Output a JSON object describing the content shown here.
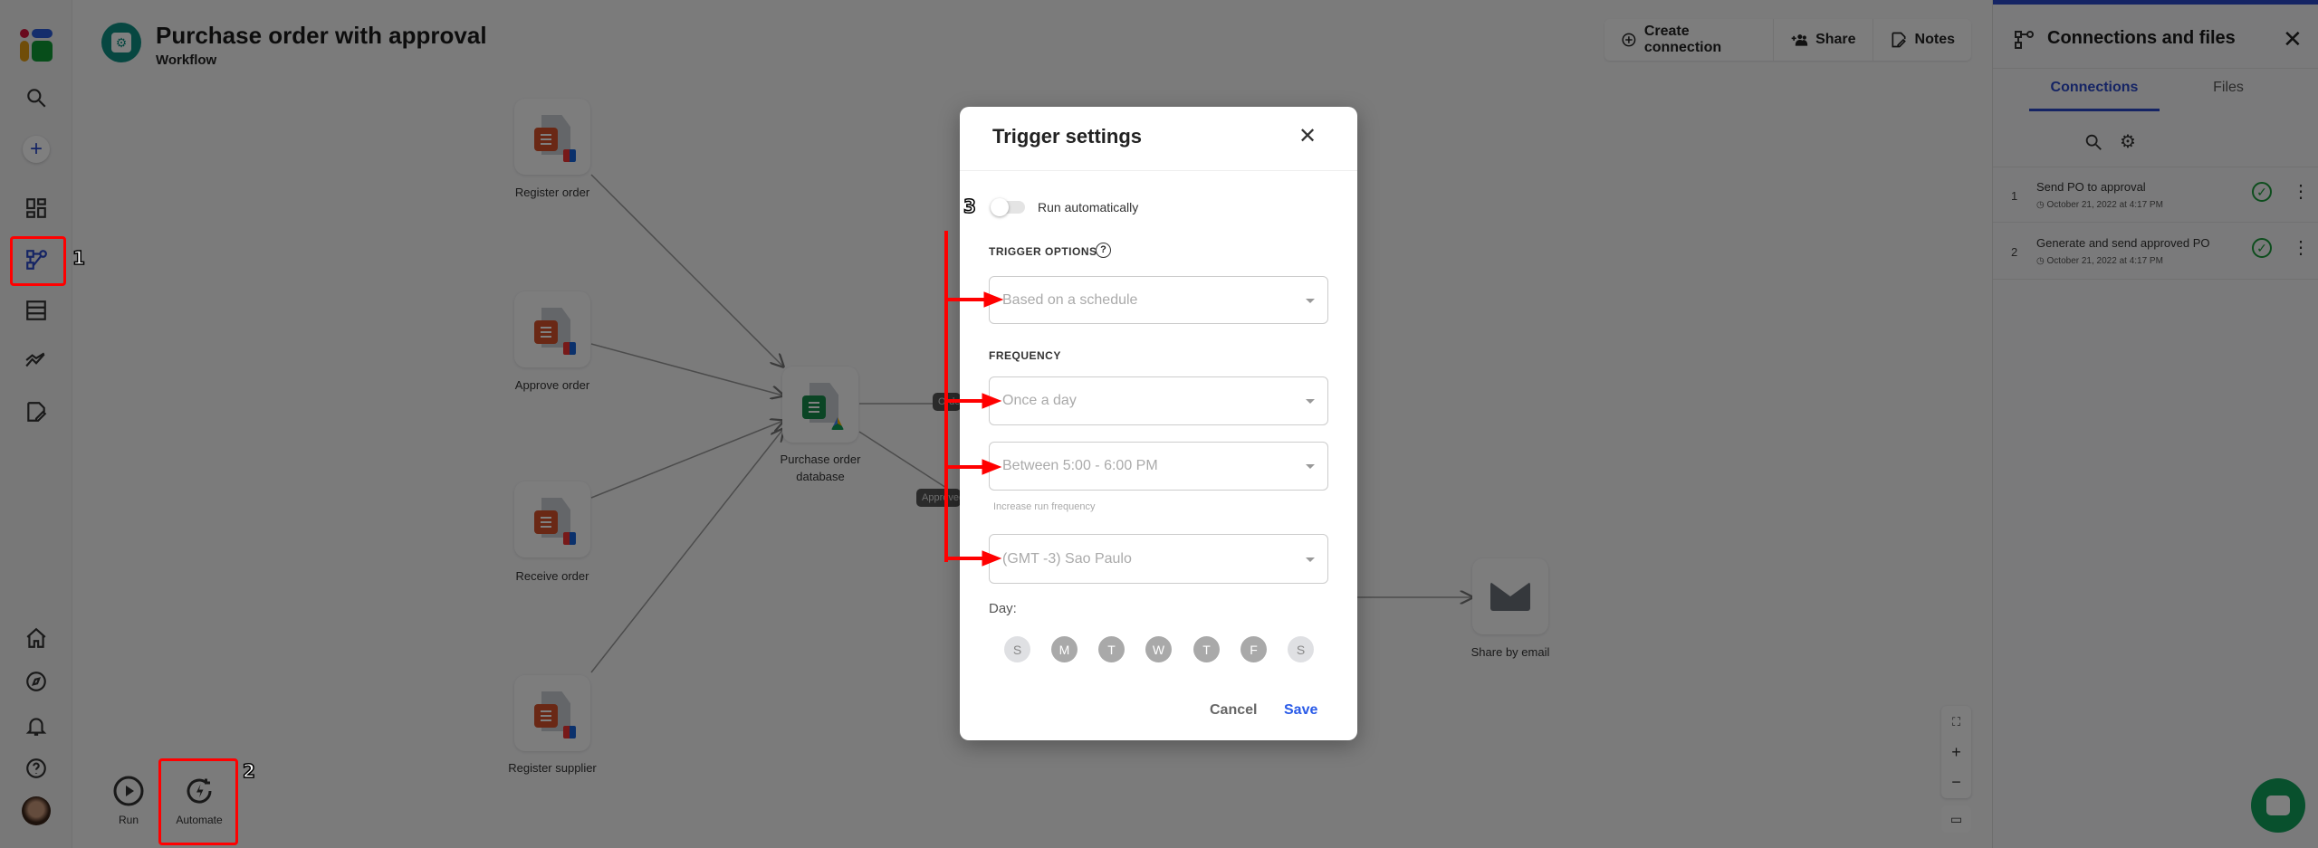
{
  "header": {
    "title": "Purchase order with approval",
    "subtitle": "Workflow"
  },
  "toolbar": {
    "create_connection": "Create connection",
    "share": "Share",
    "notes": "Notes"
  },
  "sidebar": {
    "items": [
      "search-icon",
      "add-icon",
      "dashboard-icon",
      "workflow-icon",
      "table-icon",
      "analytics-icon",
      "edit-document-icon",
      "home-icon",
      "compass-icon",
      "bell-icon",
      "help-icon",
      "avatar"
    ]
  },
  "canvas": {
    "nodes": [
      {
        "label": "Register order"
      },
      {
        "label": "Approve order"
      },
      {
        "label": "Receive order"
      },
      {
        "label": "Register supplier"
      },
      {
        "label": "Purchase order database"
      },
      {
        "label": "Share by email"
      }
    ],
    "edge_labels": [
      "Order",
      "Approved"
    ],
    "bottom_actions": {
      "run": "Run",
      "automate": "Automate"
    }
  },
  "right_panel": {
    "title": "Connections and files",
    "tabs": [
      {
        "label": "Connections",
        "active": true
      },
      {
        "label": "Files",
        "active": false
      }
    ],
    "connections": [
      {
        "index": "1",
        "name": "Send PO to approval",
        "date": "October 21, 2022 at 4:17 PM",
        "status": "ok"
      },
      {
        "index": "2",
        "name": "Generate and send approved PO",
        "date": "October 21, 2022 at 4:17 PM",
        "status": "ok"
      }
    ]
  },
  "modal": {
    "title": "Trigger settings",
    "toggle_label": "Run automatically",
    "toggle_on": false,
    "trigger_options_label": "TRIGGER OPTIONS",
    "trigger_option": "Based on a schedule",
    "frequency_label": "FREQUENCY",
    "frequency": "Once a day",
    "time_window": "Between 5:00 - 6:00 PM",
    "hint": "Increase run frequency",
    "timezone": "(GMT -3) Sao Paulo",
    "day_label": "Day:",
    "days": [
      "S",
      "M",
      "T",
      "W",
      "T",
      "F",
      "S"
    ],
    "cancel": "Cancel",
    "save": "Save"
  },
  "annotations": [
    "1",
    "2",
    "3"
  ],
  "colors": {
    "accent": "#2a48c8",
    "teal": "#0f8f82",
    "success": "#1a9a3a",
    "annotation": "#ff0000"
  }
}
